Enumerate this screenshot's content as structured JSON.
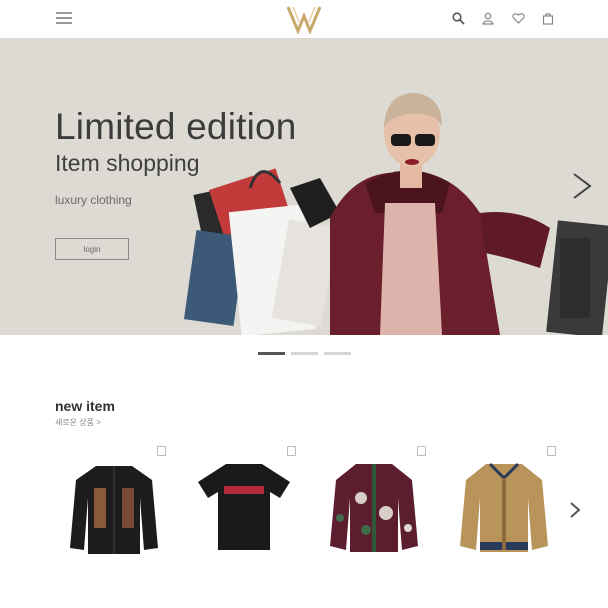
{
  "header": {
    "menu_icon": "hamburger-icon",
    "logo_icon": "brand-logo-icon",
    "icons": [
      "search-icon",
      "user-icon",
      "heart-icon",
      "cart-icon"
    ]
  },
  "hero": {
    "title": "Limited edition",
    "subtitle": "Item shopping",
    "tagline": "luxury clothing",
    "button_label": "login",
    "next_icon": "chevron-right-icon"
  },
  "carousel": {
    "slides": 3,
    "active_index": 0
  },
  "new_items": {
    "title": "new item",
    "subtitle": "새로운 상품 >",
    "next_icon": "chevron-right-icon",
    "products": [
      {
        "name": "black-embroidered-jacket"
      },
      {
        "name": "black-logo-tshirt"
      },
      {
        "name": "floral-bomber-jacket"
      },
      {
        "name": "monogram-track-jacket"
      }
    ]
  },
  "colors": {
    "hero_bg": "#dcdad3",
    "text_dark": "#3c3c3c",
    "logo_gold": "#c9a96a"
  }
}
